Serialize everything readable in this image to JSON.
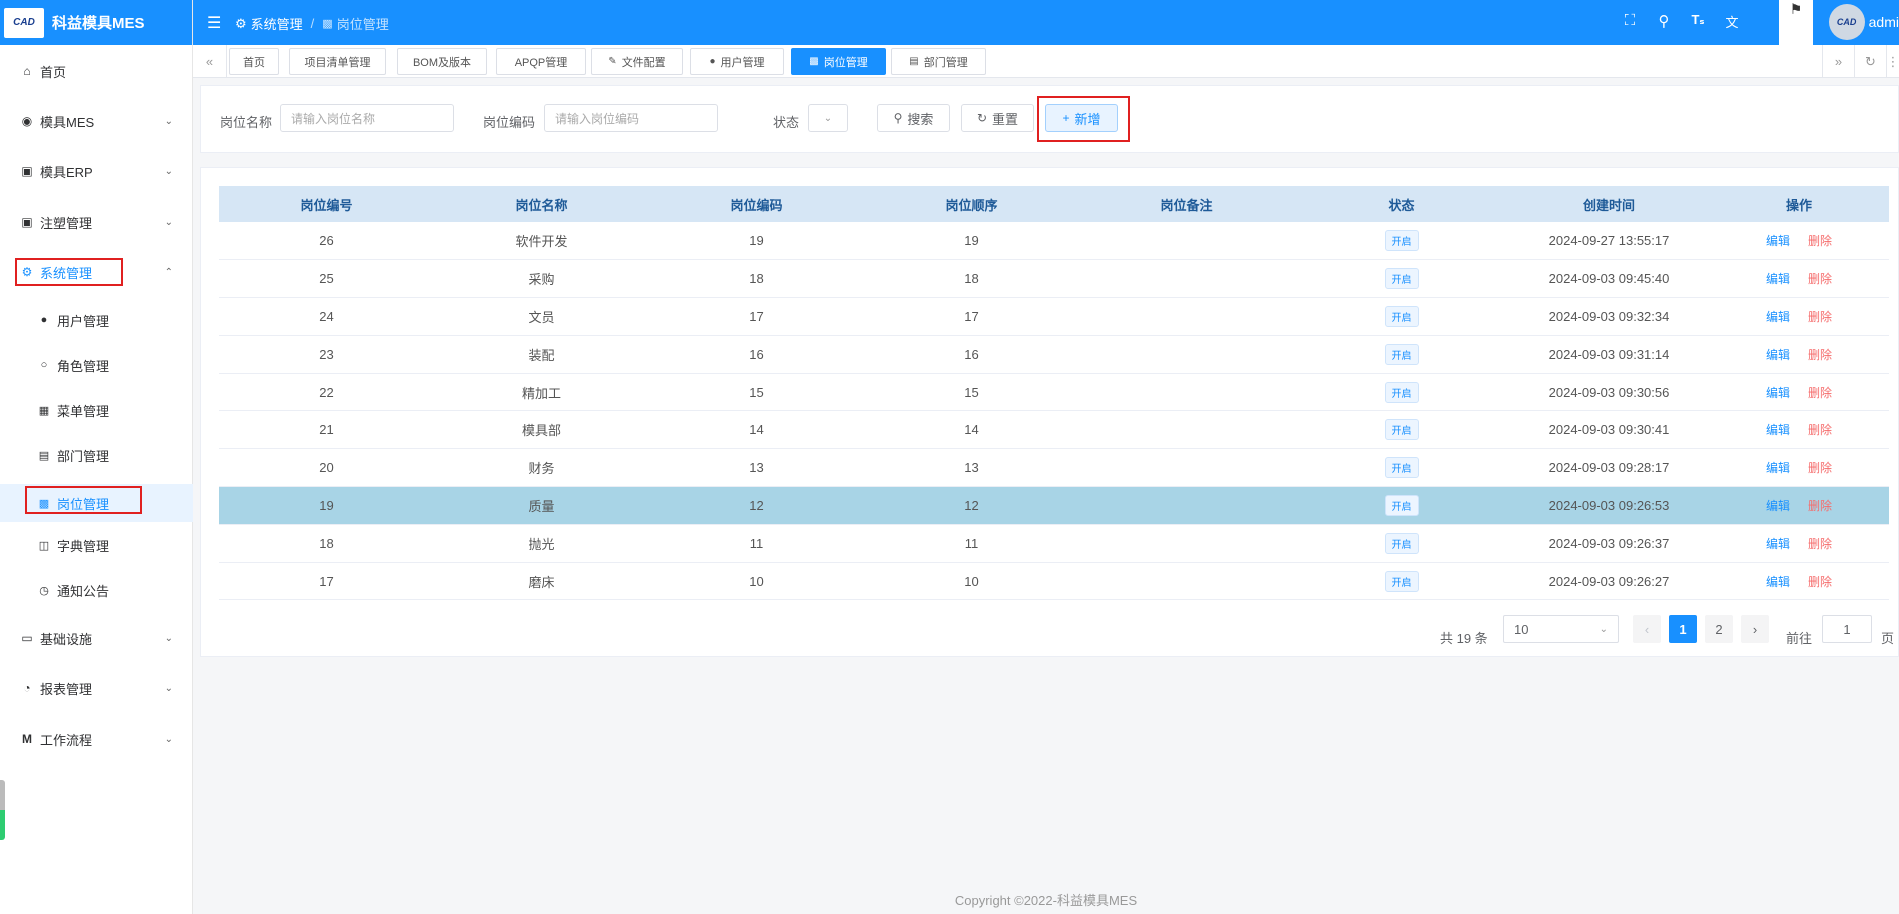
{
  "app": {
    "title": "科益模具MES",
    "logo_text": "CAD"
  },
  "header": {
    "breadcrumb": [
      "系统管理",
      "岗位管理"
    ],
    "user_name": "admi"
  },
  "sidebar": {
    "items": [
      {
        "label": "首页",
        "icon": "home-icon"
      },
      {
        "label": "模具MES",
        "icon": "camera-icon"
      },
      {
        "label": "模具ERP",
        "icon": "briefcase-icon"
      },
      {
        "label": "注塑管理",
        "icon": "briefcase-icon"
      },
      {
        "label": "系统管理",
        "icon": "gear-icon"
      },
      {
        "label": "基础设施",
        "icon": "monitor-icon"
      },
      {
        "label": "报表管理",
        "icon": "pie-icon"
      },
      {
        "label": "工作流程",
        "icon": "flow-icon"
      }
    ],
    "sub_items": [
      {
        "label": "用户管理",
        "icon": "user-icon"
      },
      {
        "label": "角色管理",
        "icon": "user-outline-icon"
      },
      {
        "label": "菜单管理",
        "icon": "grid-icon"
      },
      {
        "label": "部门管理",
        "icon": "card-icon"
      },
      {
        "label": "岗位管理",
        "icon": "badge-icon"
      },
      {
        "label": "字典管理",
        "icon": "book-icon"
      },
      {
        "label": "通知公告",
        "icon": "chat-icon"
      }
    ]
  },
  "tabs": [
    {
      "label": "首页"
    },
    {
      "label": "项目清单管理"
    },
    {
      "label": "BOM及版本"
    },
    {
      "label": "APQP管理"
    },
    {
      "label": "文件配置"
    },
    {
      "label": "用户管理"
    },
    {
      "label": "岗位管理"
    },
    {
      "label": "部门管理"
    }
  ],
  "search": {
    "name_label": "岗位名称",
    "name_placeholder": "请输入岗位名称",
    "code_label": "岗位编码",
    "code_placeholder": "请输入岗位编码",
    "status_label": "状态",
    "search_btn": "搜索",
    "reset_btn": "重置",
    "add_btn": "新增"
  },
  "table": {
    "headers": [
      "岗位编号",
      "岗位名称",
      "岗位编码",
      "岗位顺序",
      "岗位备注",
      "状态",
      "创建时间",
      "操作"
    ],
    "edit_label": "编辑",
    "delete_label": "删除",
    "rows": [
      {
        "id": "26",
        "name": "软件开发",
        "code": "19",
        "order": "19",
        "remark": "",
        "status": "开启",
        "created": "2024-09-27 13:55:17"
      },
      {
        "id": "25",
        "name": "采购",
        "code": "18",
        "order": "18",
        "remark": "",
        "status": "开启",
        "created": "2024-09-03 09:45:40"
      },
      {
        "id": "24",
        "name": "文员",
        "code": "17",
        "order": "17",
        "remark": "",
        "status": "开启",
        "created": "2024-09-03 09:32:34"
      },
      {
        "id": "23",
        "name": "装配",
        "code": "16",
        "order": "16",
        "remark": "",
        "status": "开启",
        "created": "2024-09-03 09:31:14"
      },
      {
        "id": "22",
        "name": "精加工",
        "code": "15",
        "order": "15",
        "remark": "",
        "status": "开启",
        "created": "2024-09-03 09:30:56"
      },
      {
        "id": "21",
        "name": "模具部",
        "code": "14",
        "order": "14",
        "remark": "",
        "status": "开启",
        "created": "2024-09-03 09:30:41"
      },
      {
        "id": "20",
        "name": "财务",
        "code": "13",
        "order": "13",
        "remark": "",
        "status": "开启",
        "created": "2024-09-03 09:28:17"
      },
      {
        "id": "19",
        "name": "质量",
        "code": "12",
        "order": "12",
        "remark": "",
        "status": "开启",
        "created": "2024-09-03 09:26:53"
      },
      {
        "id": "18",
        "name": "抛光",
        "code": "11",
        "order": "11",
        "remark": "",
        "status": "开启",
        "created": "2024-09-03 09:26:37"
      },
      {
        "id": "17",
        "name": "磨床",
        "code": "10",
        "order": "10",
        "remark": "",
        "status": "开启",
        "created": "2024-09-03 09:26:27"
      }
    ]
  },
  "pagination": {
    "total_text": "共 19 条",
    "page_size": "10",
    "pages": [
      "1",
      "2"
    ],
    "goto_label": "前往",
    "goto_value": "1",
    "page_suffix": "页"
  },
  "footer": {
    "copyright": "Copyright ©2022-科益模具MES"
  }
}
